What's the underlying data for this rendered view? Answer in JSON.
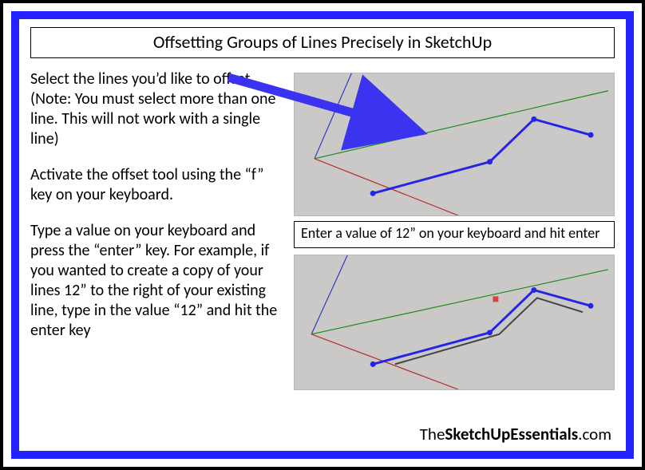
{
  "title": "Offsetting Groups of Lines Precisely in SketchUp",
  "instructions": {
    "p1": "Select the lines you’d like to offset. (Note: You must select more than one line. This will not work with a single line)",
    "p2": "Activate the offset tool using the “f” key on your keyboard.",
    "p3": "Type a value on your keyboard and press the “enter” key. For example, if you wanted to create a copy of your lines 12” to the right of your existing line, type in the value “12” and hit the enter key"
  },
  "caption": "Enter a value of 12” on your keyboard and hit enter",
  "footer": {
    "pre": "The",
    "bold1": "SketchUp",
    "bold2": "Essentials",
    "post": ".com"
  }
}
